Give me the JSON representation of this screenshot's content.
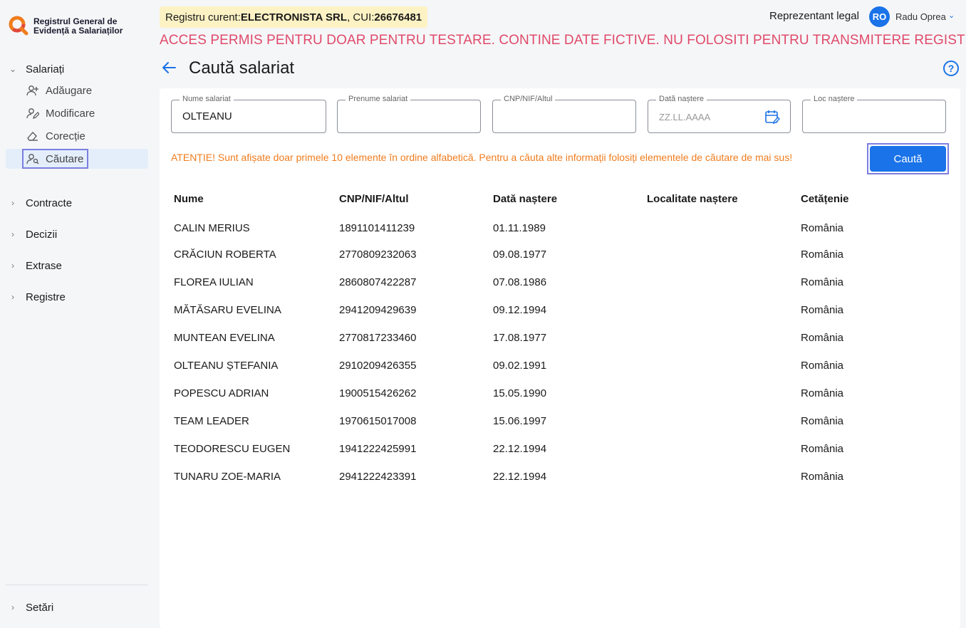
{
  "app": {
    "logo_line1": "Registrul General de",
    "logo_line2": "Evidență a Salariaților"
  },
  "sidebar": {
    "groups": [
      {
        "label": "Salariați",
        "expanded": true
      },
      {
        "label": "Contracte"
      },
      {
        "label": "Decizii"
      },
      {
        "label": "Extrase"
      },
      {
        "label": "Registre"
      },
      {
        "label": "Setări"
      }
    ],
    "sub_items": [
      {
        "label": "Adăugare",
        "icon": "user-add-icon"
      },
      {
        "label": "Modificare",
        "icon": "user-edit-icon"
      },
      {
        "label": "Corecție",
        "icon": "eraser-icon"
      },
      {
        "label": "Căutare",
        "icon": "user-search-icon",
        "active": true
      }
    ]
  },
  "header": {
    "registru_prefix": "Registru curent: ",
    "company": "ELECTRONISTA SRL",
    "cui_prefix": ", CUI: ",
    "cui": "26676481",
    "role": "Reprezentant legal",
    "avatar_initials": "RO",
    "user_name": "Radu Oprea",
    "warning": "ACCES PERMIS PENTRU DOAR PENTRU TESTARE. CONTINE DATE FICTIVE. NU FOLOSITI PENTRU TRANSMITERE REGISTRU"
  },
  "page": {
    "title": "Caută salariat",
    "help_label": "?"
  },
  "search": {
    "nume_label": "Nume salariat",
    "nume_value": "OLTEANU",
    "prenume_label": "Prenume salariat",
    "cnp_label": "CNP/NIF/Altul",
    "data_label": "Dată naștere",
    "data_placeholder": "ZZ.LL.AAAA",
    "loc_label": "Loc naștere",
    "button": "Caută",
    "notice": "ATENȚIE! Sunt afișate doar primele 10 elemente în ordine alfabetică. Pentru a căuta alte informații folosiți elementele de căutare de mai sus!"
  },
  "table": {
    "headers": [
      "Nume",
      "CNP/NIF/Altul",
      "Dată naștere",
      "Localitate naștere",
      "Cetățenie"
    ],
    "rows": [
      [
        "CALIN MERIUS",
        "1891101411239",
        "01.11.1989",
        "",
        "România"
      ],
      [
        "CRĂCIUN ROBERTA",
        "2770809232063",
        "09.08.1977",
        "",
        "România"
      ],
      [
        "FLOREA IULIAN",
        "2860807422287",
        "07.08.1986",
        "",
        "România"
      ],
      [
        "MĂTĂSARU  EVELINA",
        "2941209429639",
        "09.12.1994",
        "",
        "România"
      ],
      [
        "MUNTEAN EVELINA",
        "2770817233460",
        "17.08.1977",
        "",
        "România"
      ],
      [
        "OLTEANU  ȘTEFANIA",
        "2910209426355",
        "09.02.1991",
        "",
        "România"
      ],
      [
        "POPESCU ADRIAN",
        "1900515426262",
        "15.05.1990",
        "",
        "România"
      ],
      [
        "TEAM LEADER",
        "1970615017008",
        "15.06.1997",
        "",
        "România"
      ],
      [
        "TEODORESCU EUGEN",
        "1941222425991",
        "22.12.1994",
        "",
        "România"
      ],
      [
        "TUNARU ZOE-MARIA",
        "2941222423391",
        "22.12.1994",
        "",
        "România"
      ]
    ]
  },
  "colors": {
    "accent": "#1a73e8",
    "warning": "#e04a6a",
    "notice": "#f07c1d",
    "registru_bg": "#fdf2c4"
  }
}
